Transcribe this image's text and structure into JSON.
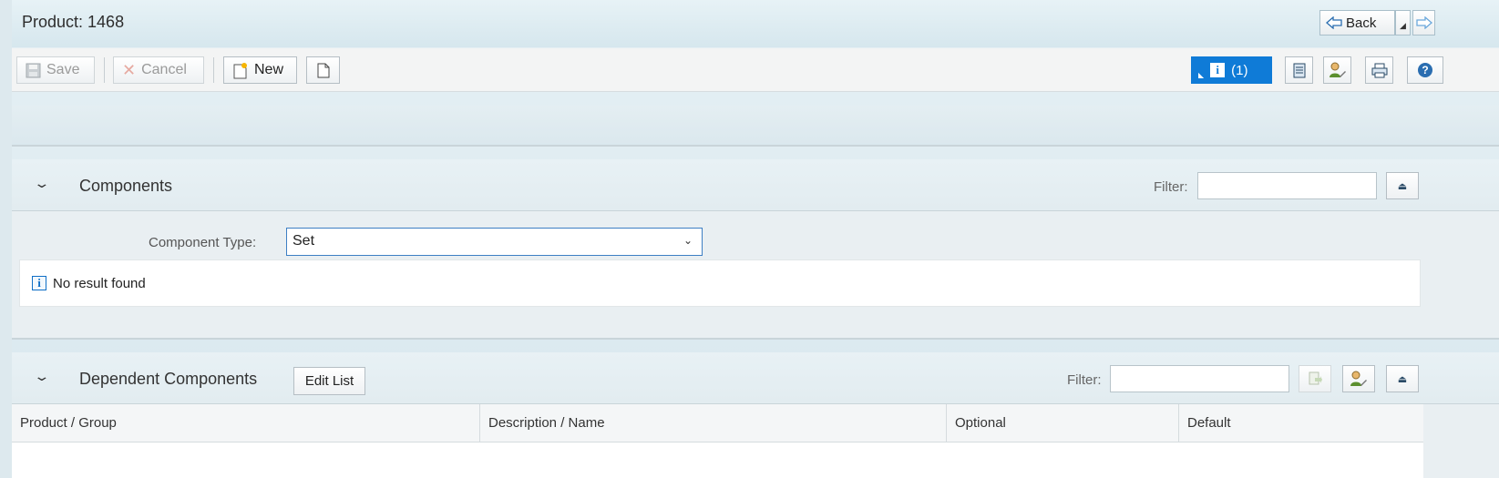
{
  "header": {
    "title": "Product: 1468",
    "back_label": "Back"
  },
  "toolbar": {
    "save_label": "Save",
    "cancel_label": "Cancel",
    "new_label": "New",
    "messages_label": "(1)"
  },
  "components": {
    "title": "Components",
    "filter_label": "Filter:",
    "filter_value": "",
    "component_type_label": "Component Type:",
    "component_type_value": "Set",
    "no_result_text": "No result found"
  },
  "dependent": {
    "title": "Dependent Components",
    "edit_list_label": "Edit List",
    "filter_label": "Filter:",
    "filter_value": "",
    "columns": [
      "Product / Group",
      "Description / Name",
      "Optional",
      "Default"
    ]
  },
  "colors": {
    "accent": "#0f7bd7",
    "background": "#dce9ef"
  }
}
